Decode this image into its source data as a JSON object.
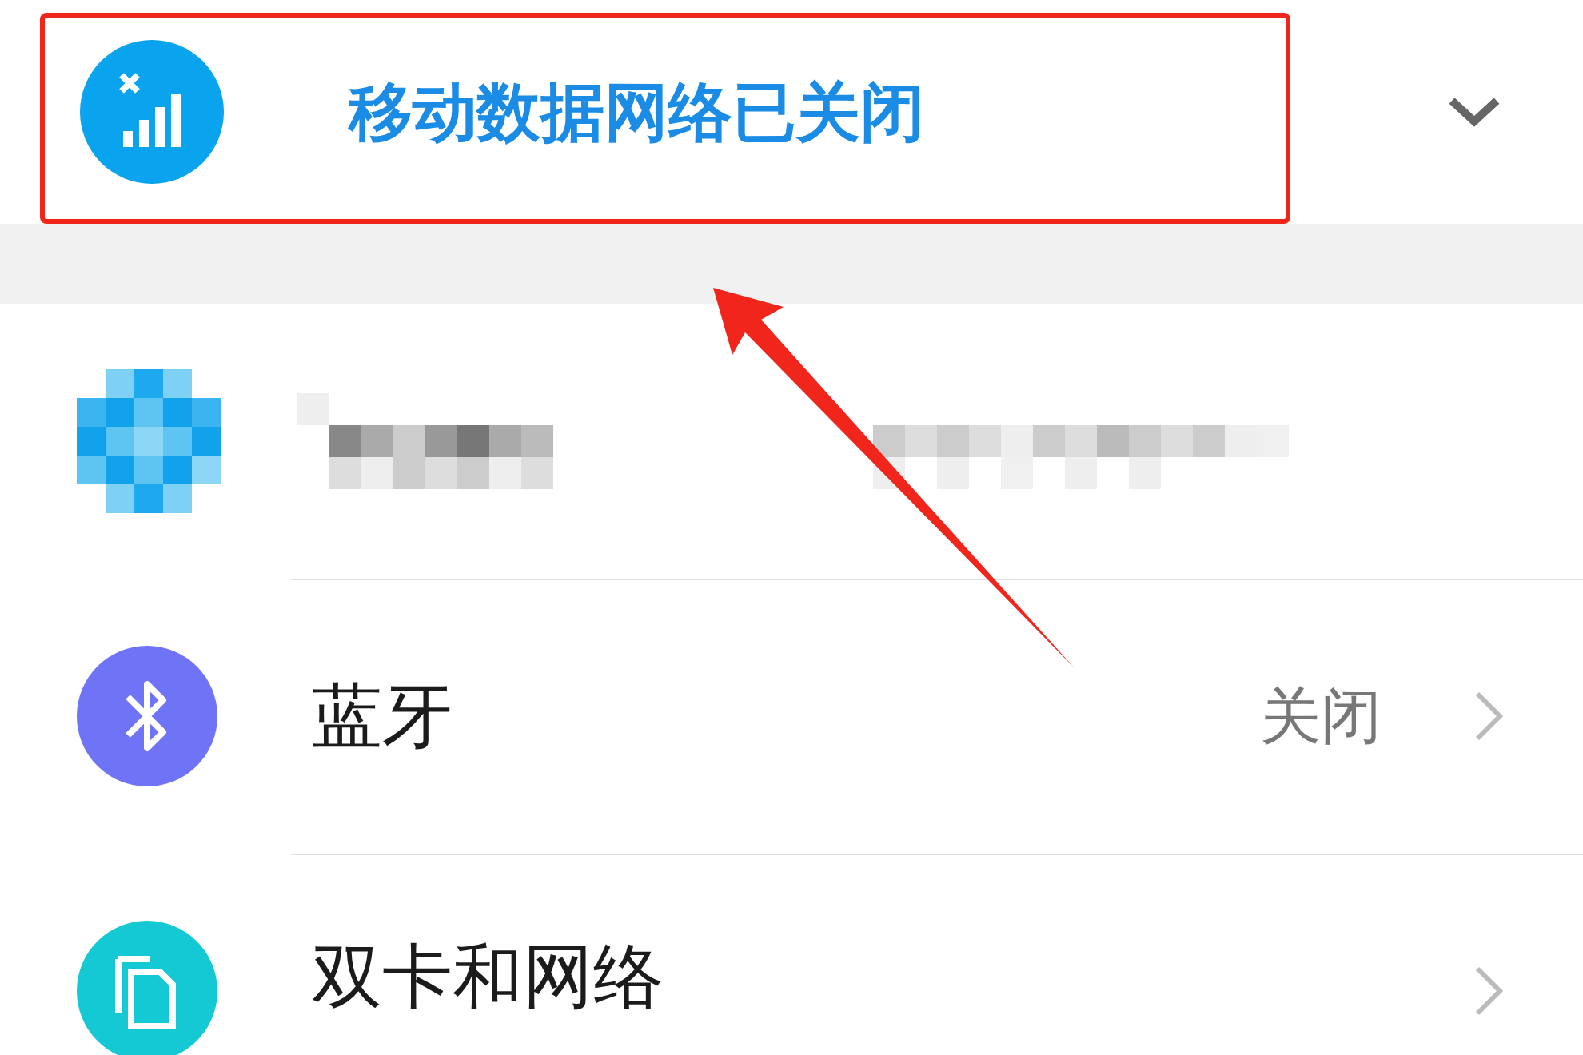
{
  "notice": {
    "title": "移动数据网络已关闭",
    "expanded": false
  },
  "items": [
    {
      "kind": "hidden"
    },
    {
      "kind": "bluetooth",
      "label": "蓝牙",
      "status": "关闭"
    },
    {
      "kind": "sim",
      "label": "双卡和网络"
    }
  ],
  "annotation": {
    "kind": "highlight"
  }
}
